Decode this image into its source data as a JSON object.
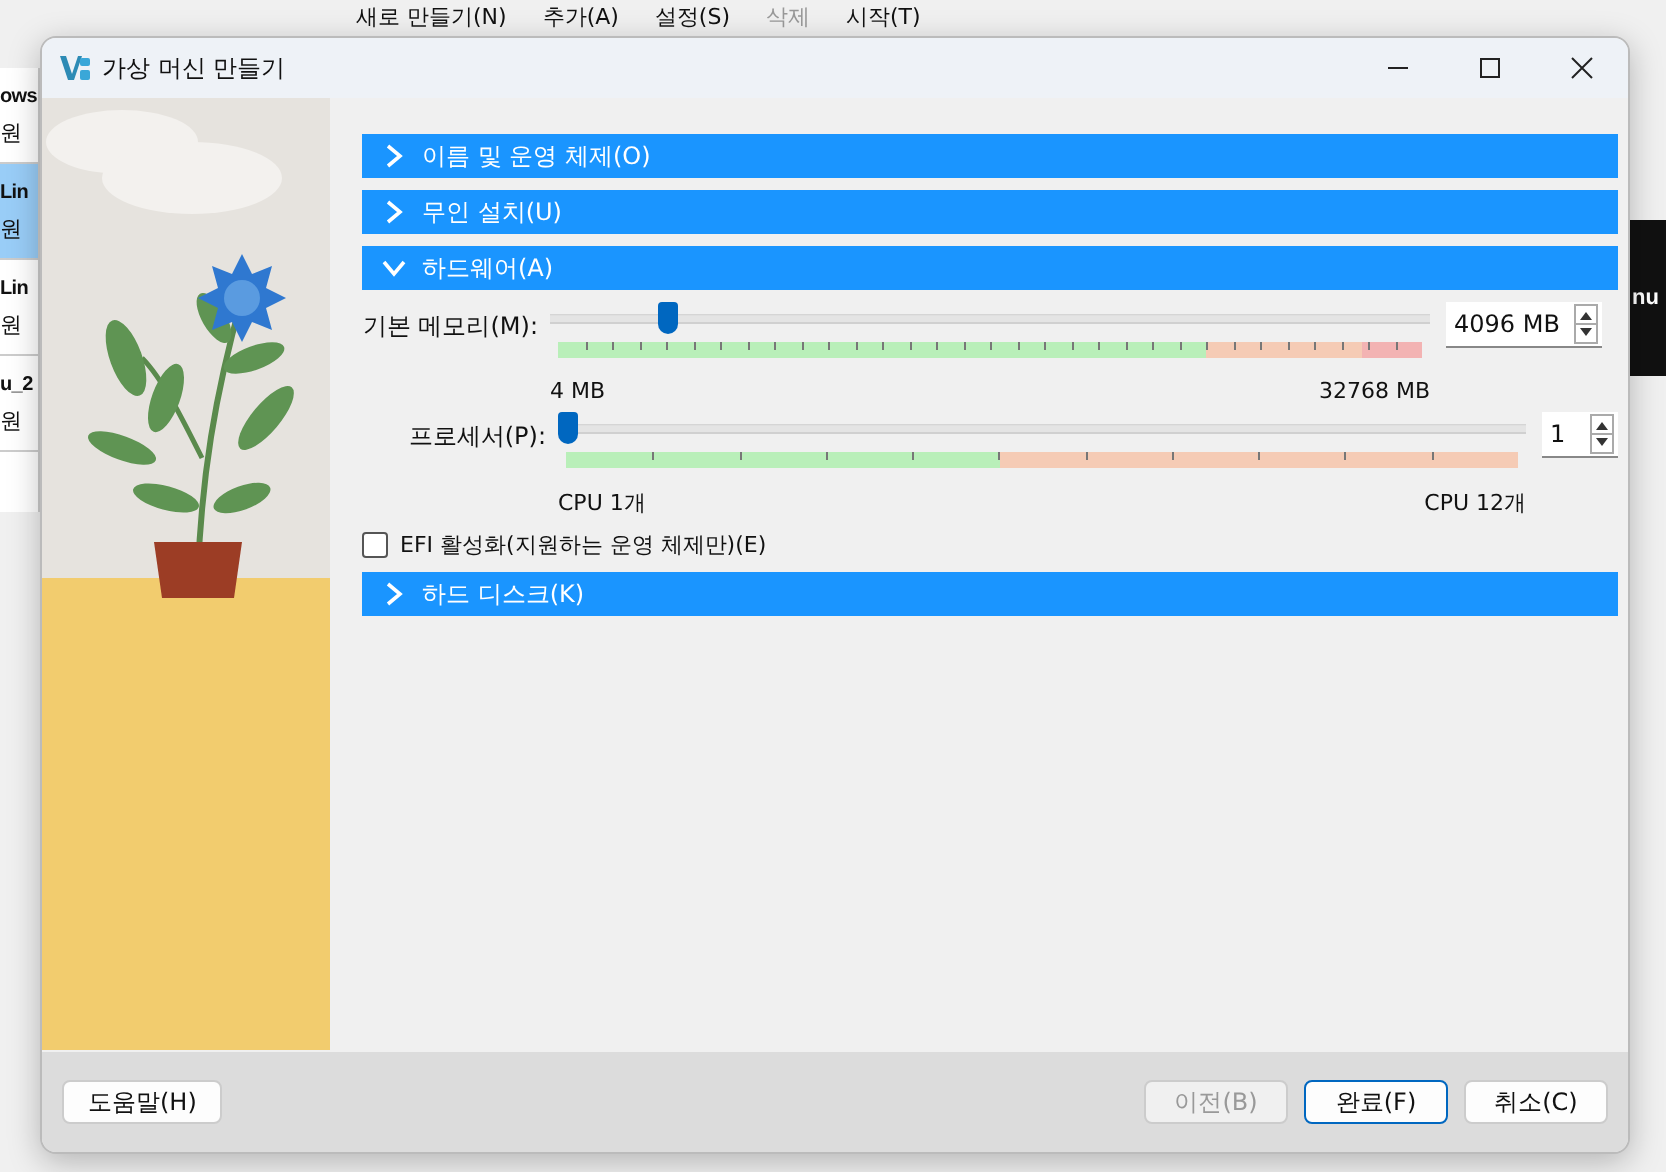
{
  "background_app": {
    "toolbar": [
      {
        "label": "새로 만들기(N)",
        "disabled": false
      },
      {
        "label": "추가(A)",
        "disabled": false
      },
      {
        "label": "설정(S)",
        "disabled": false
      },
      {
        "label": "삭제",
        "disabled": true
      },
      {
        "label": "시작(T)",
        "disabled": false
      }
    ],
    "vm_list": [
      {
        "name": "ows",
        "state": "원",
        "selected": false
      },
      {
        "name": "Lin",
        "state": "원",
        "selected": true
      },
      {
        "name": "Lin",
        "state": "원",
        "selected": false
      },
      {
        "name": "u_2",
        "state": "원",
        "selected": false
      }
    ],
    "preview_text": "nu"
  },
  "dialog": {
    "title": "가상 머신 만들기",
    "sections": [
      {
        "label": "이름 및 운영 체제(O)",
        "expanded": false
      },
      {
        "label": "무인 설치(U)",
        "expanded": false
      },
      {
        "label": "하드웨어(A)",
        "expanded": true,
        "content": {
          "memory": {
            "label": "기본 메모리(M):",
            "level": 0.125,
            "value": "4096 MB",
            "min_label": "4 MB",
            "max_label": "32768 MB"
          },
          "processor": {
            "label": "프로세서(P):",
            "level": 0,
            "value": "1",
            "min_label": "CPU 1개",
            "max_label": "CPU 12개"
          },
          "efi": {
            "label": "EFI 활성화(지원하는 운영 체제만)(E)",
            "checked": false
          }
        }
      },
      {
        "label": "하드 디스크(K)",
        "expanded": false
      }
    ],
    "help_button": "도움말(H)",
    "buttons": [
      {
        "label": "이전(B)",
        "disabled": true,
        "default": false
      },
      {
        "label": "완료(F)",
        "disabled": false,
        "default": true
      },
      {
        "label": "취소(C)",
        "disabled": false,
        "default": false
      }
    ]
  }
}
